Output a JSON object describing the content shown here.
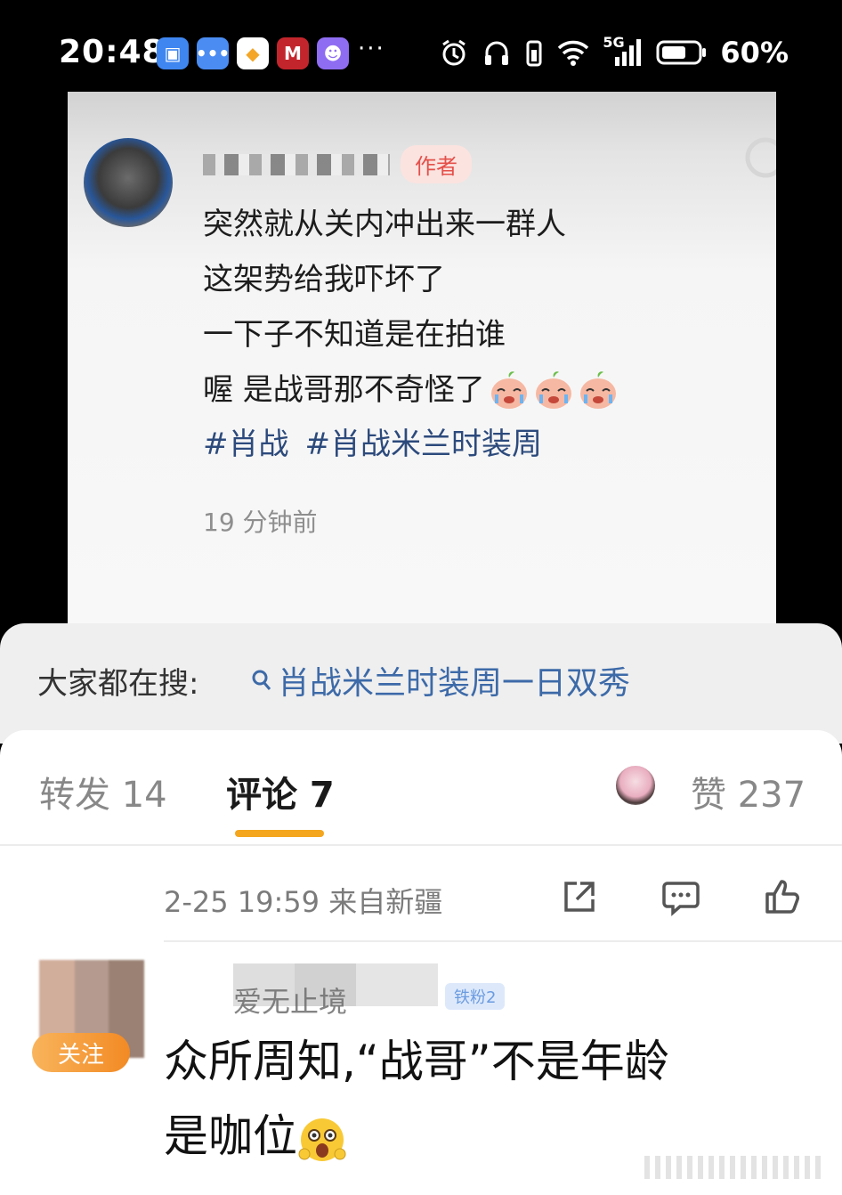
{
  "status_bar": {
    "time": "20:48",
    "dots": "···",
    "signal_label": "5G",
    "battery": "60%"
  },
  "post": {
    "author_badge": "作者",
    "lines": [
      "突然就从关内冲出来一群人",
      "这架势给我吓坏了",
      "一下子不知道是在拍谁",
      "喔 是战哥那不奇怪了"
    ],
    "tags": [
      "#肖战",
      "#肖战米兰时装周"
    ],
    "time": "19 分钟前"
  },
  "suggestion": {
    "label": "大家都在搜:",
    "query": "肖战米兰时装周一日双秀"
  },
  "tabs": {
    "repost": "转发 14",
    "comment": "评论 7",
    "like": "赞 237"
  },
  "meta": {
    "datetime": "2-25 19:59",
    "source": "来自新疆"
  },
  "comment": {
    "follow_label": "关注",
    "username": "爱无止境",
    "level": "铁粉2",
    "text_line1": "众所周知,“战哥”不是年龄",
    "text_line2": "是咖位"
  },
  "colors": {
    "accent": "#f4a61e",
    "link": "#3d6aa8",
    "author_badge": "#e4504a"
  }
}
